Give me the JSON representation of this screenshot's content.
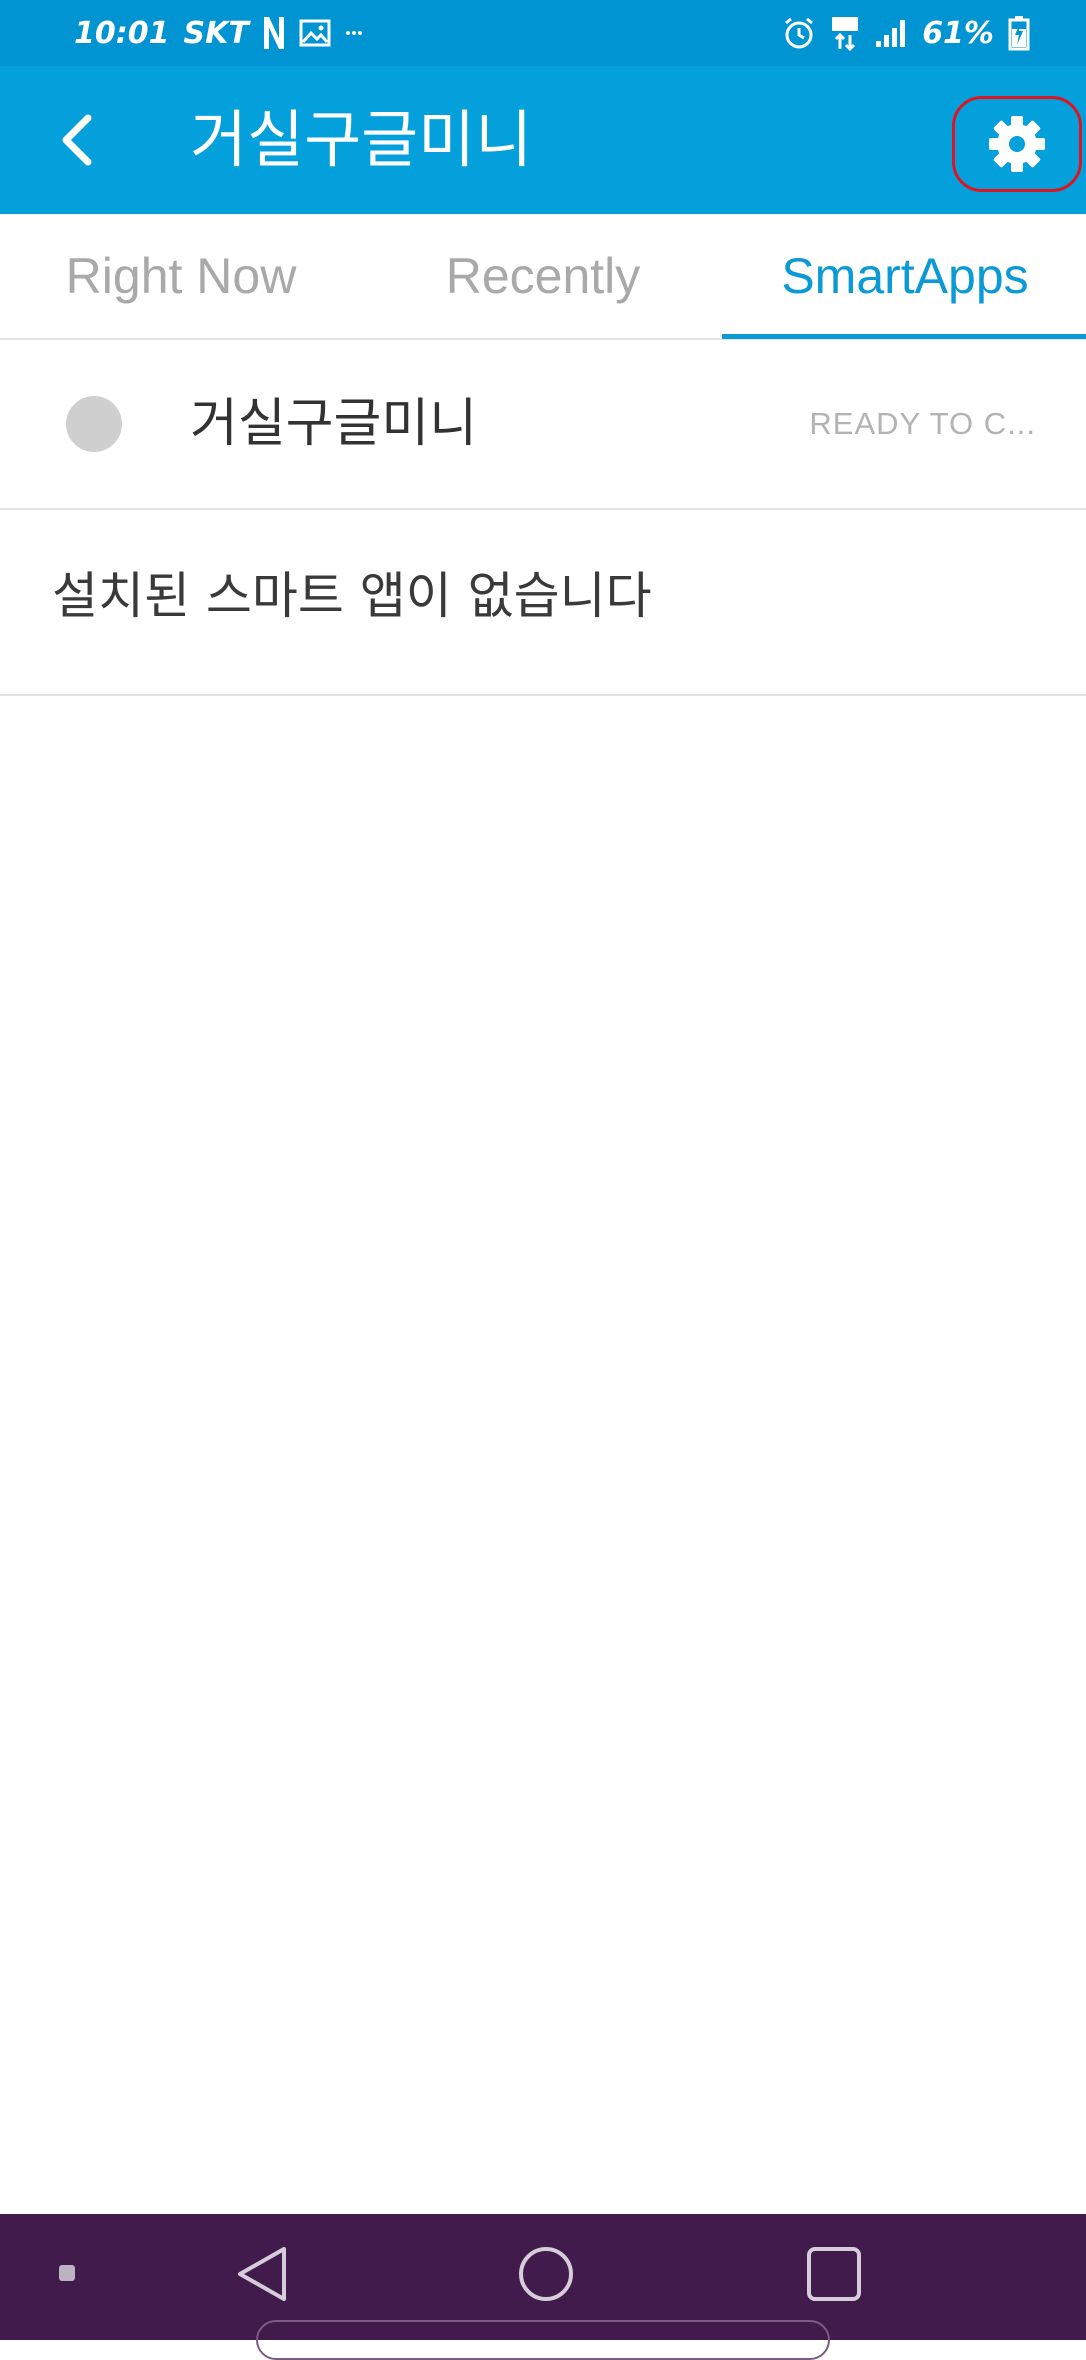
{
  "status_bar": {
    "time": "10:01",
    "carrier": "SKT",
    "battery": "61%",
    "icons": [
      "netflix-icon",
      "gallery-icon",
      "more-icon",
      "alarm-icon",
      "lte-icon",
      "signal-icon",
      "battery-icon"
    ]
  },
  "app_bar": {
    "title": "거실구글미니",
    "back_icon": "chevron-left-icon",
    "settings_icon": "gear-icon"
  },
  "tabs": [
    {
      "label": "Right Now",
      "active": false
    },
    {
      "label": "Recently",
      "active": false
    },
    {
      "label": "SmartApps",
      "active": true
    }
  ],
  "device": {
    "name": "거실구글미니",
    "status": "READY TO C..."
  },
  "empty_message": "설치된 스마트 앱이 없습니다",
  "nav_bar": {
    "items": [
      "dot-icon",
      "back-triangle-icon",
      "home-circle-icon",
      "recents-square-icon"
    ]
  },
  "colors": {
    "status_bar": "#0194d2",
    "app_bar": "#03a0dc",
    "accent": "#0c9ad6",
    "highlight_border": "#e0141e",
    "nav_bar": "#401b4c"
  }
}
